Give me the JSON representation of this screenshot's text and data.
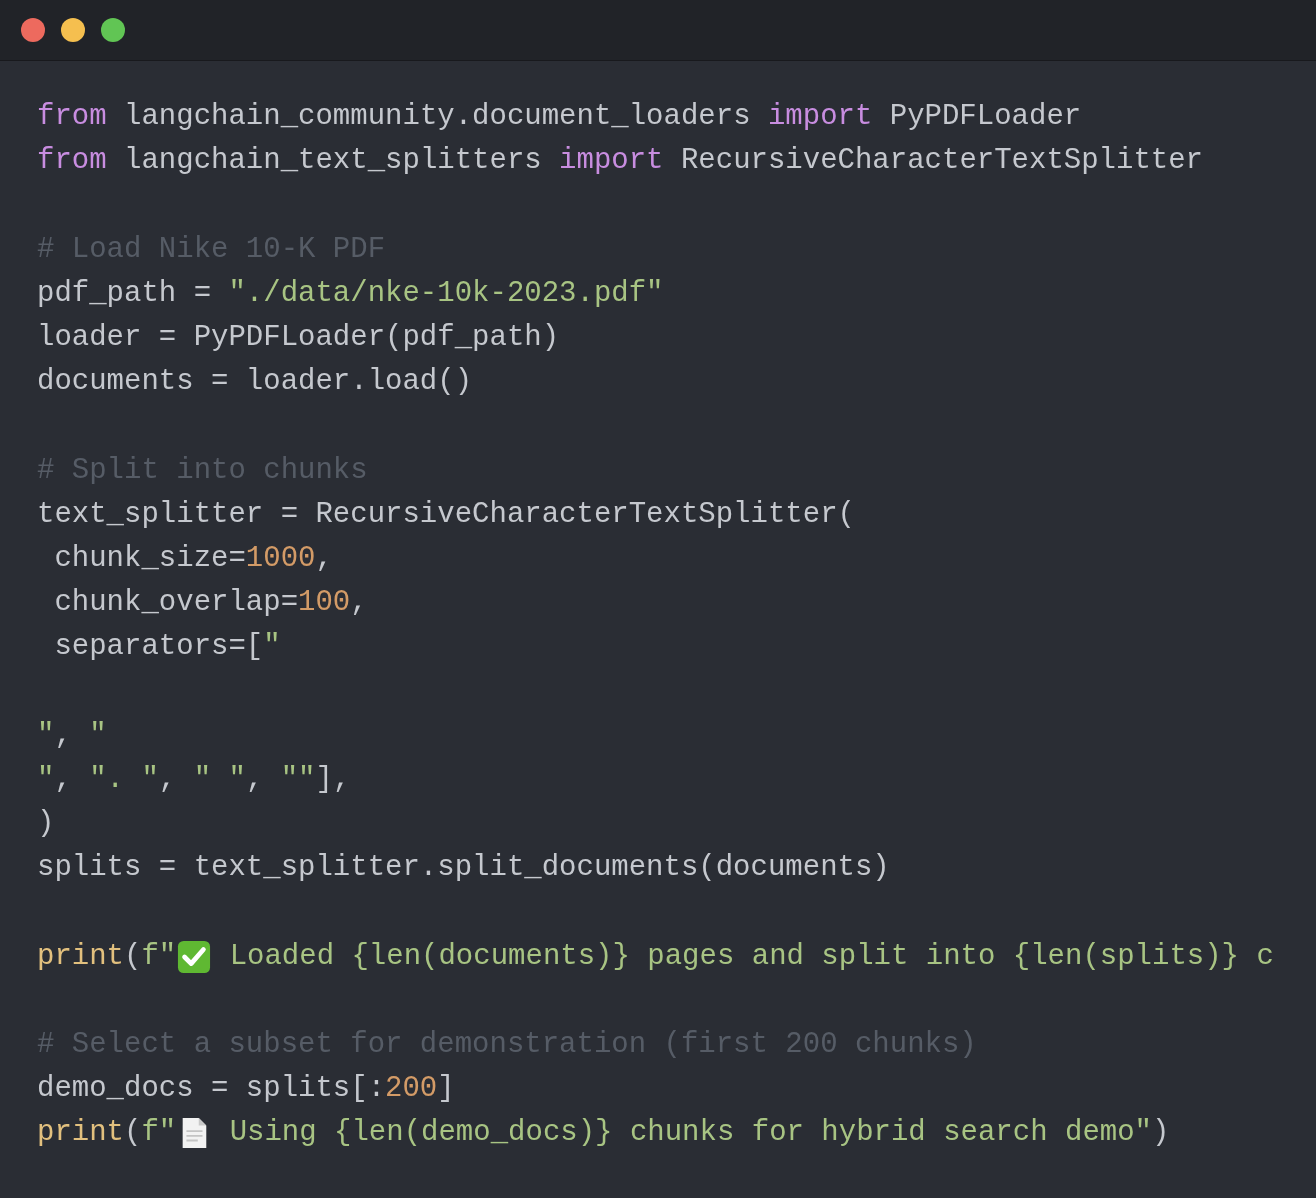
{
  "window": {
    "controls": [
      {
        "kind": "close"
      },
      {
        "kind": "minimize"
      },
      {
        "kind": "zoom"
      }
    ]
  },
  "lines": [
    {
      "kind": "code",
      "tokens": [
        {
          "kind": "keyword",
          "text": "from"
        },
        {
          "kind": "plain",
          "text": " langchain_community.document_loaders "
        },
        {
          "kind": "keyword",
          "text": "import"
        },
        {
          "kind": "plain",
          "text": " PyPDFLoader"
        }
      ]
    },
    {
      "kind": "code",
      "tokens": [
        {
          "kind": "keyword",
          "text": "from"
        },
        {
          "kind": "plain",
          "text": " langchain_text_splitters "
        },
        {
          "kind": "keyword",
          "text": "import"
        },
        {
          "kind": "plain",
          "text": " RecursiveCharacterTextSplitter"
        }
      ]
    },
    {
      "kind": "blank"
    },
    {
      "kind": "code",
      "tokens": [
        {
          "kind": "comment",
          "text": "# Load Nike 10-K PDF"
        }
      ]
    },
    {
      "kind": "code",
      "tokens": [
        {
          "kind": "plain",
          "text": "pdf_path = "
        },
        {
          "kind": "string",
          "text": "\"./data/nke-10k-2023.pdf\""
        }
      ]
    },
    {
      "kind": "code",
      "tokens": [
        {
          "kind": "plain",
          "text": "loader = PyPDFLoader(pdf_path)"
        }
      ]
    },
    {
      "kind": "code",
      "tokens": [
        {
          "kind": "plain",
          "text": "documents = loader.load()"
        }
      ]
    },
    {
      "kind": "blank"
    },
    {
      "kind": "code",
      "tokens": [
        {
          "kind": "comment",
          "text": "# Split into chunks"
        }
      ]
    },
    {
      "kind": "code",
      "tokens": [
        {
          "kind": "plain",
          "text": "text_splitter = RecursiveCharacterTextSplitter("
        }
      ]
    },
    {
      "kind": "code",
      "tokens": [
        {
          "kind": "plain",
          "text": " chunk_size="
        },
        {
          "kind": "number",
          "text": "1000"
        },
        {
          "kind": "plain",
          "text": ","
        }
      ]
    },
    {
      "kind": "code",
      "tokens": [
        {
          "kind": "plain",
          "text": " chunk_overlap="
        },
        {
          "kind": "number",
          "text": "100"
        },
        {
          "kind": "plain",
          "text": ","
        }
      ]
    },
    {
      "kind": "code",
      "tokens": [
        {
          "kind": "plain",
          "text": " separators=["
        },
        {
          "kind": "string",
          "text": "\""
        }
      ]
    },
    {
      "kind": "blank"
    },
    {
      "kind": "code",
      "tokens": [
        {
          "kind": "string",
          "text": "\""
        },
        {
          "kind": "plain",
          "text": ", "
        },
        {
          "kind": "string",
          "text": "\""
        }
      ]
    },
    {
      "kind": "code",
      "tokens": [
        {
          "kind": "string",
          "text": "\""
        },
        {
          "kind": "plain",
          "text": ", "
        },
        {
          "kind": "string",
          "text": "\". \""
        },
        {
          "kind": "plain",
          "text": ", "
        },
        {
          "kind": "string",
          "text": "\" \""
        },
        {
          "kind": "plain",
          "text": ", "
        },
        {
          "kind": "string",
          "text": "\"\""
        },
        {
          "kind": "plain",
          "text": "],"
        }
      ]
    },
    {
      "kind": "code",
      "tokens": [
        {
          "kind": "plain",
          "text": ")"
        }
      ]
    },
    {
      "kind": "code",
      "tokens": [
        {
          "kind": "plain",
          "text": "splits = text_splitter.split_documents(documents)"
        }
      ]
    },
    {
      "kind": "blank"
    },
    {
      "kind": "code",
      "tokens": [
        {
          "kind": "function",
          "text": "print"
        },
        {
          "kind": "plain",
          "text": "("
        },
        {
          "kind": "string",
          "text": "f\""
        },
        {
          "kind": "check"
        },
        {
          "kind": "string",
          "text": " Loaded {len(documents)} pages and split into {len(splits)} c"
        }
      ]
    },
    {
      "kind": "blank"
    },
    {
      "kind": "code",
      "tokens": [
        {
          "kind": "comment",
          "text": "# Select a subset for demonstration (first 200 chunks)"
        }
      ]
    },
    {
      "kind": "code",
      "tokens": [
        {
          "kind": "plain",
          "text": "demo_docs = splits[:"
        },
        {
          "kind": "number",
          "text": "200"
        },
        {
          "kind": "plain",
          "text": "]"
        }
      ]
    },
    {
      "kind": "code",
      "tokens": [
        {
          "kind": "function",
          "text": "print"
        },
        {
          "kind": "plain",
          "text": "("
        },
        {
          "kind": "string",
          "text": "f\""
        },
        {
          "kind": "doc"
        },
        {
          "kind": "string",
          "text": " Using {len(demo_docs)} chunks for hybrid search demo\""
        },
        {
          "kind": "plain",
          "text": ")"
        }
      ]
    }
  ]
}
